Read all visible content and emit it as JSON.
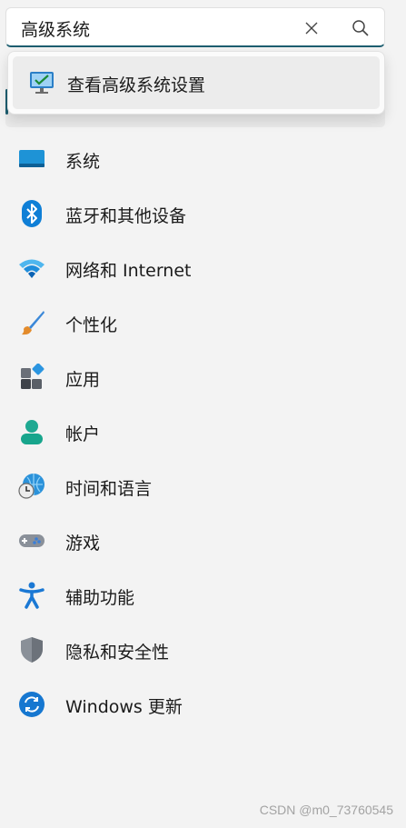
{
  "search": {
    "value": "高级系统",
    "clear_icon": "close-icon",
    "search_icon": "search-icon"
  },
  "suggestions": [
    {
      "label": "查看高级系统设置",
      "icon": "system-properties-icon"
    }
  ],
  "nav": {
    "items": [
      {
        "label": "系统",
        "icon": "display-icon"
      },
      {
        "label": "蓝牙和其他设备",
        "icon": "bluetooth-icon"
      },
      {
        "label": "网络和 Internet",
        "icon": "wifi-icon"
      },
      {
        "label": "个性化",
        "icon": "paintbrush-icon"
      },
      {
        "label": "应用",
        "icon": "apps-icon"
      },
      {
        "label": "帐户",
        "icon": "person-icon"
      },
      {
        "label": "时间和语言",
        "icon": "globe-clock-icon"
      },
      {
        "label": "游戏",
        "icon": "gamepad-icon"
      },
      {
        "label": "辅助功能",
        "icon": "accessibility-icon"
      },
      {
        "label": "隐私和安全性",
        "icon": "shield-icon"
      },
      {
        "label": "Windows 更新",
        "icon": "update-icon"
      }
    ]
  },
  "watermark": "CSDN @m0_73760545",
  "colors": {
    "accent": "#1d5e70",
    "background": "#f3f3f3",
    "blue": "#0f7fd6"
  }
}
